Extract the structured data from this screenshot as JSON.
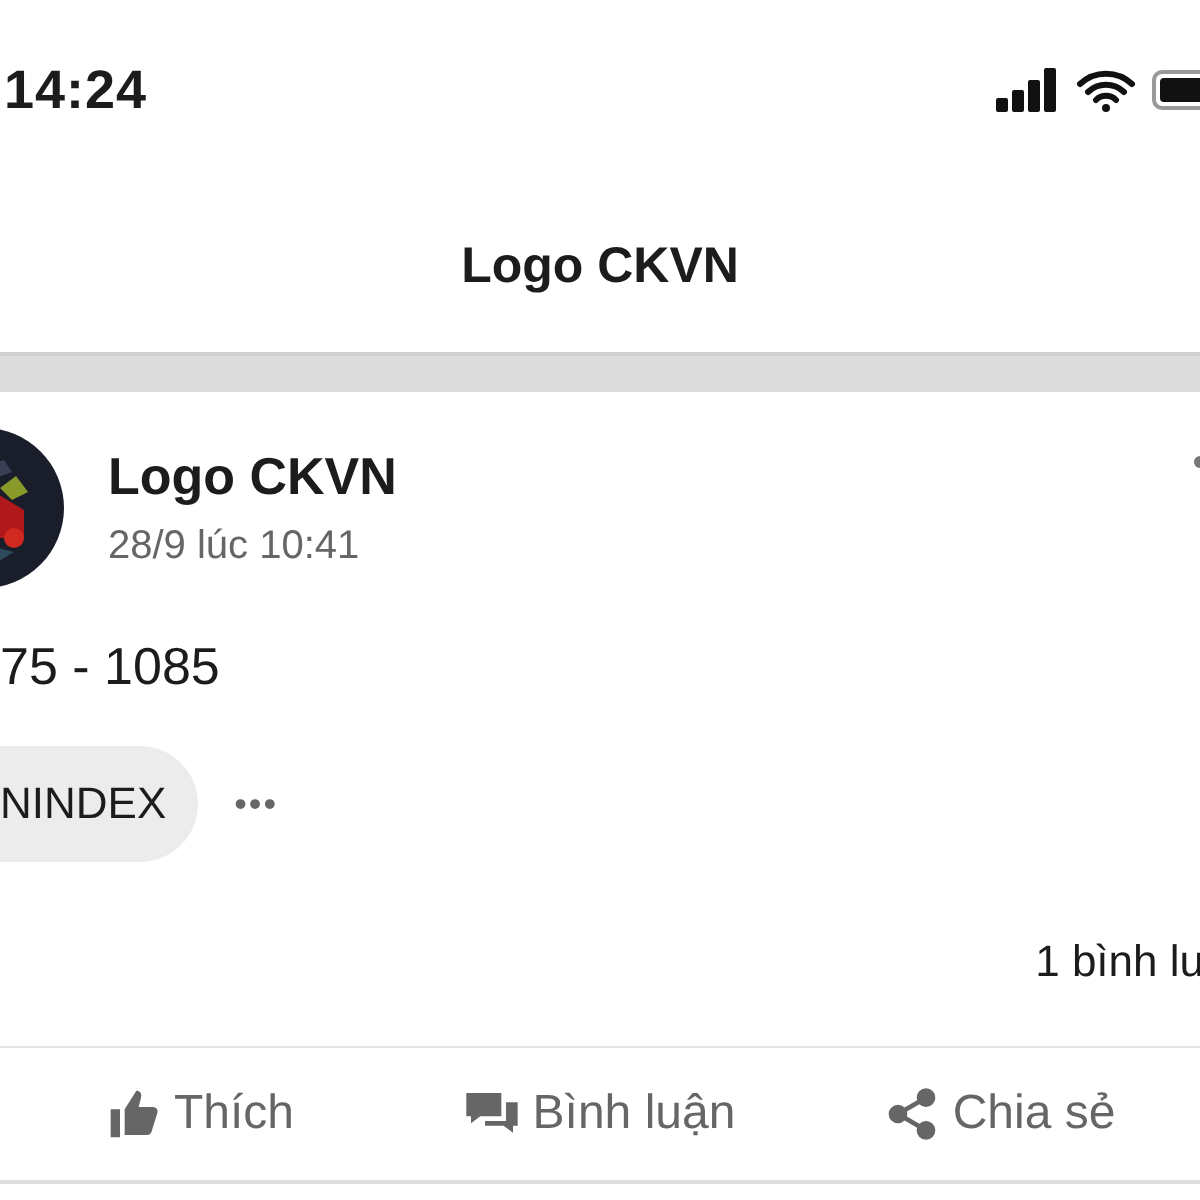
{
  "status_bar": {
    "time": "14:24"
  },
  "header": {
    "title": "Logo CKVN"
  },
  "post": {
    "author": "Logo CKVN",
    "time": "28/9 lúc 10:41",
    "text": "75 - 1085",
    "tag": "NINDEX",
    "more": "•••",
    "comments": "1 bình lu"
  },
  "actions": [
    {
      "kind": "like",
      "label": "Thích"
    },
    {
      "kind": "comment",
      "label": "Bình luận"
    },
    {
      "kind": "share",
      "label": "Chia sẻ"
    }
  ]
}
